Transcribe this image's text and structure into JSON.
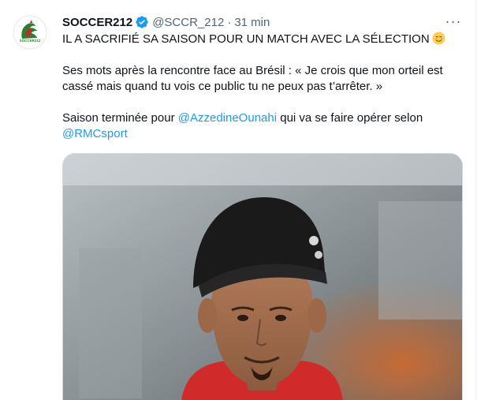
{
  "tweet": {
    "display_name": "SOCCER212",
    "handle": "@SCCR_212",
    "separator": "·",
    "time": "31 min",
    "more_label": "···",
    "line1": "IL A SACRIFIÉ SA SAISON POUR UN MATCH AVEC LA SÉLECTION",
    "line2": "Ses mots après la rencontre face au Brésil : « Je crois que mon orteil est",
    "line3": "cassé mais quand tu vois ce public tu ne peux pas t’arrêter. »",
    "line4_before": "Saison terminée pour ",
    "mention1": "@AzzedineOunahi",
    "line4_after": " qui va se faire opérer selon",
    "mention2": "@RMCsport",
    "avatar_logo_text": "SOCCER212",
    "verified_color": "#1d9bf0",
    "link_color": "#1d9bf0"
  },
  "icons": {
    "verified": "verified-badge-icon",
    "emoji": "smiling-face-with-tear-emoji",
    "more": "more-horizontal-icon"
  }
}
